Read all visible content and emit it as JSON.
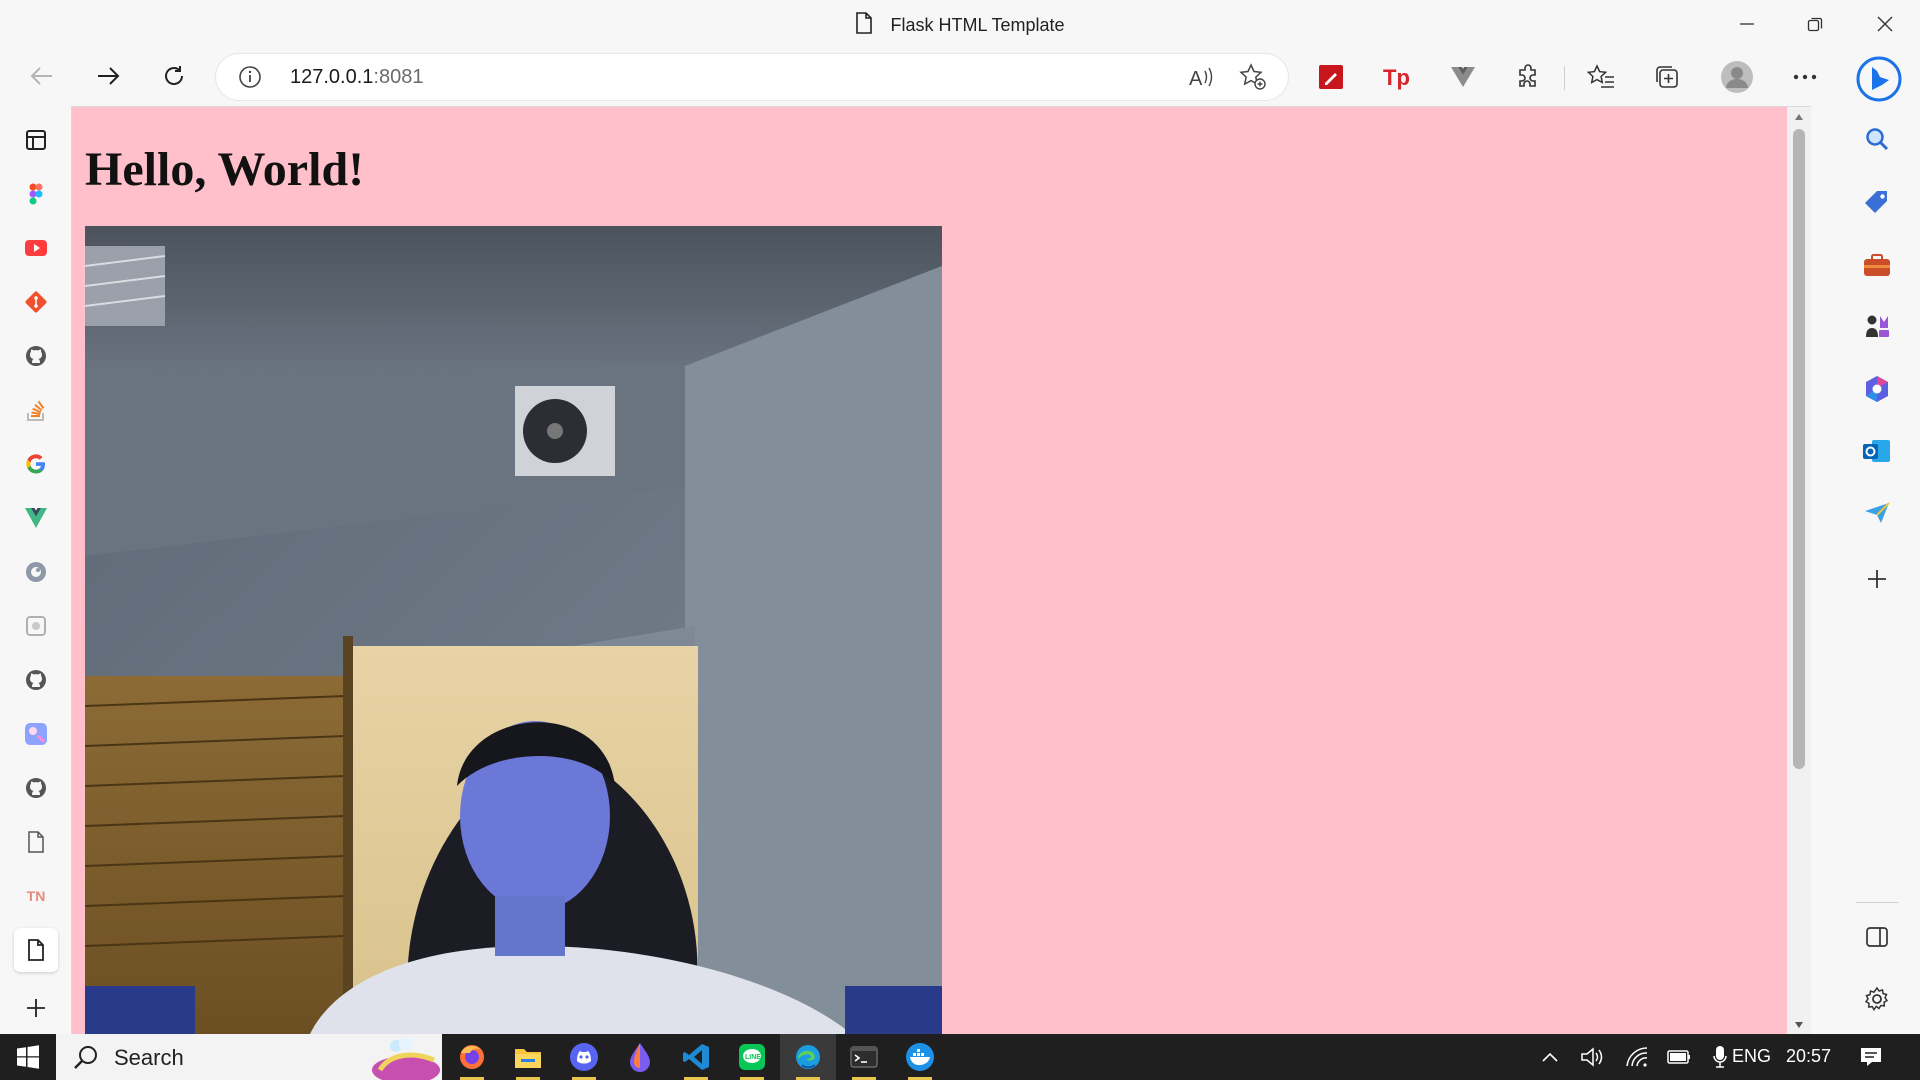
{
  "window": {
    "title": "Flask HTML Template"
  },
  "toolbar": {
    "url_host": "127.0.0.1",
    "url_port": ":8081"
  },
  "page": {
    "heading": "Hello, World!",
    "background": "#ffc0cb"
  },
  "left_sidebar": {
    "icons": [
      "tab-actions-icon",
      "figma-icon",
      "youtube-icon",
      "git-icon",
      "github-icon",
      "stackoverflow-icon",
      "google-icon",
      "vue-icon",
      "tabler-icon",
      "blank-site-icon",
      "github-icon",
      "paint-icon",
      "github-icon",
      "page-icon",
      "tn-icon",
      "page-icon",
      "add-icon"
    ],
    "tn_label": "TN"
  },
  "right_sidebar": {
    "icons": [
      "bing-icon",
      "search-icon",
      "shopping-icon",
      "tools-icon",
      "games-icon",
      "microsoft365-icon",
      "outlook-icon",
      "drop-icon",
      "add-icon",
      "split-view-icon",
      "settings-icon"
    ]
  },
  "taskbar": {
    "search_placeholder": "Search",
    "language": "ENG",
    "time": "20:57",
    "apps": [
      "windows-start-icon",
      "firefox-icon",
      "file-explorer-icon",
      "discord-icon",
      "drop-app-icon",
      "vscode-icon",
      "line-icon",
      "edge-icon",
      "terminal-icon",
      "docker-icon"
    ]
  }
}
